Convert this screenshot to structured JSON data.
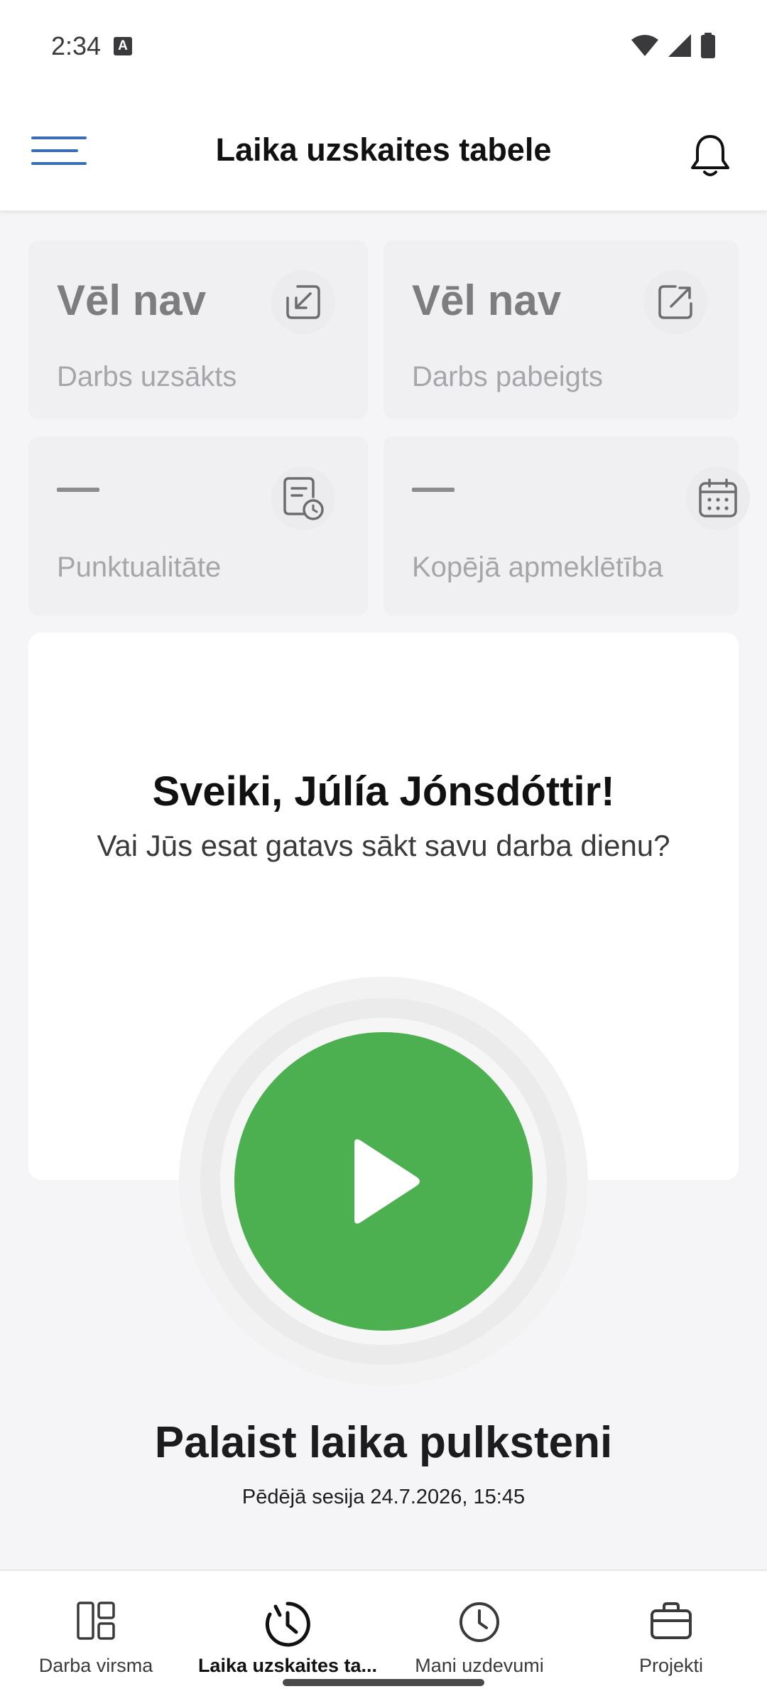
{
  "status_bar": {
    "time": "2:34",
    "notification_glyph": "A"
  },
  "app_bar": {
    "title": "Laika uzskaites tabele",
    "menu_icon": "hamburger-menu-icon",
    "notification_icon": "bell-icon"
  },
  "stats": {
    "work_started": {
      "value": "Vēl nav",
      "label": "Darbs uzsākts",
      "icon": "sign-in-arrow-icon"
    },
    "work_finished": {
      "value": "Vēl nav",
      "label": "Darbs pabeigts",
      "icon": "sign-out-arrow-icon"
    },
    "punctuality": {
      "value": "—",
      "label": "Punktualitāte",
      "icon": "document-clock-icon"
    },
    "attendance": {
      "value": "—",
      "label": "Kopējā apmeklētība",
      "icon": "calendar-icon"
    }
  },
  "greeting": {
    "title": "Sveiki, Júlía Jónsdóttir!",
    "subtitle": "Vai Jūs esat gatavs sākt savu darba dienu?"
  },
  "timer": {
    "play_icon": "play-icon",
    "title": "Palaist laika pulksteni",
    "last_session": "Pēdējā sesija 24.7.2026, 15:45"
  },
  "bottom_nav": {
    "items": [
      {
        "label": "Darba virsma",
        "icon": "dashboard-icon"
      },
      {
        "label": "Laika uzskaites ta...",
        "icon": "clock-timer-icon",
        "active": true
      },
      {
        "label": "Mani uzdevumi",
        "icon": "clock-icon"
      },
      {
        "label": "Projekti",
        "icon": "briefcase-icon"
      }
    ]
  },
  "colors": {
    "accent_blue": "#3a6db5",
    "play_green": "#4caf50",
    "background": "#f5f5f7",
    "card": "#f0f0f2"
  }
}
